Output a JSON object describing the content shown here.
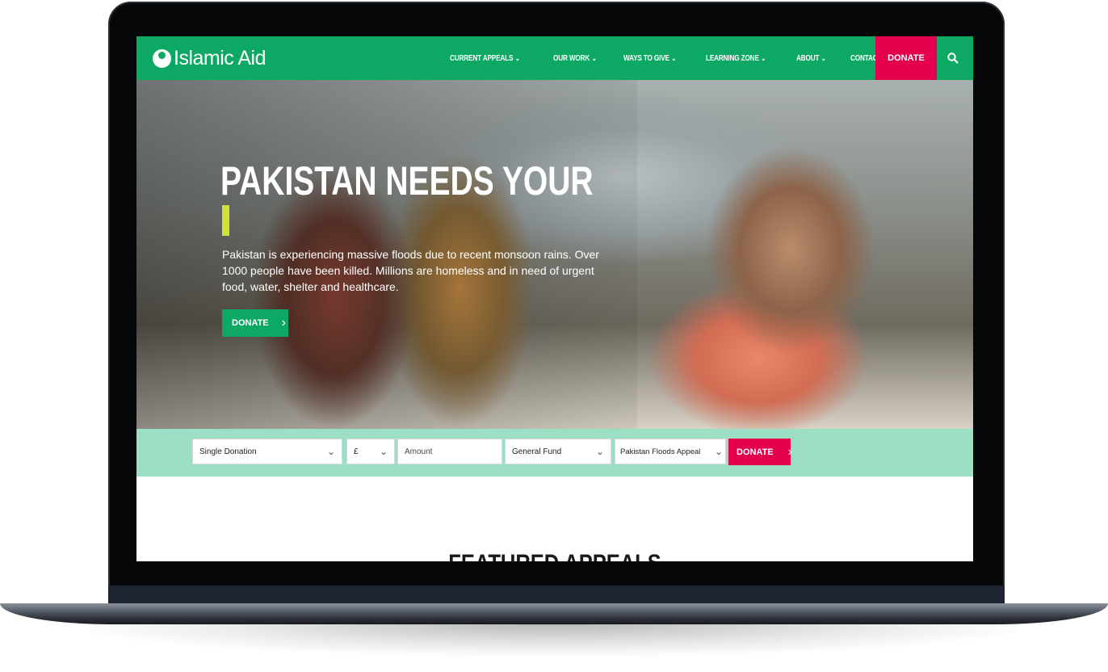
{
  "brand": {
    "name": "Islamic Aid"
  },
  "nav": {
    "items": [
      {
        "label": "CURRENT APPEALS",
        "has_dropdown": true
      },
      {
        "label": "OUR WORK",
        "has_dropdown": true
      },
      {
        "label": "WAYS TO GIVE",
        "has_dropdown": true
      },
      {
        "label": "LEARNING ZONE",
        "has_dropdown": true
      },
      {
        "label": "ABOUT",
        "has_dropdown": true
      },
      {
        "label": "CONTACT",
        "has_dropdown": false
      }
    ],
    "donate_label": "DONATE",
    "search_icon": "search-icon"
  },
  "hero": {
    "title": "PAKISTAN NEEDS YOUR",
    "body": "Pakistan is experiencing massive floods due to recent monsoon rains. Over 1000 people have been killed. Millions are homeless and in need of urgent food, water, shelter and healthcare.",
    "button_label": "DONATE",
    "arrow_icon": "chevron-right-icon"
  },
  "donation_bar": {
    "type_select": "Single Donation",
    "currency_select": "£",
    "amount_placeholder": "Amount",
    "fund_select": "General Fund",
    "appeal_select": "Pakistan Floods Appeal",
    "button_label": "DONATE"
  },
  "featured": {
    "heading": "FEATURED APPEALS"
  },
  "colors": {
    "brand_green": "#0ca864",
    "donate_pink": "#e5004f",
    "bar_mint": "#9ddfc4",
    "cursor_yellow": "#cfe23a"
  }
}
